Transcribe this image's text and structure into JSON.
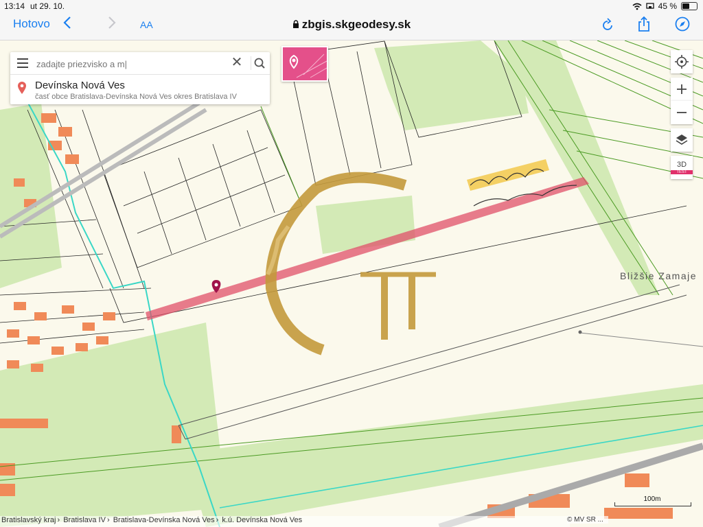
{
  "status_bar": {
    "time": "13:14",
    "date": "ut 29. 10.",
    "battery_level": "45 %",
    "battery_fraction": 0.45
  },
  "browser": {
    "done_label": "Hotovo",
    "text_size_label": "AA",
    "url": "zbgis.skgeodesy.sk",
    "icons": [
      "back-icon",
      "forward-icon",
      "lock-icon",
      "reload-icon",
      "share-icon",
      "compass-icon"
    ]
  },
  "search": {
    "placeholder": "zadajte priezvisko a m|",
    "result_title": "Devínska Nová Ves",
    "result_subtitle": "časť obce Bratislava-Devínska Nová Ves okres Bratislava IV"
  },
  "map_controls": {
    "threed_label": "3D",
    "test_badge": "TEST",
    "icons": [
      "locate-icon",
      "zoom-in-icon",
      "zoom-out-icon",
      "layers-icon"
    ]
  },
  "map": {
    "place_label": "Bližšie Zamaje",
    "scale_label": "100m",
    "attribution": "© MV SR ...",
    "colors": {
      "highlight_parcel": "#e0506a",
      "vegetation": "#d3eab6",
      "buildings": "#f08a58",
      "water_boundary": "#3ad7c6",
      "watermark_gold": "#c49a3c",
      "marker": "#a0124a"
    }
  },
  "breadcrumb": [
    "Bratislavský kraj",
    "Bratislava IV",
    "Bratislava-Devínska Nová Ves",
    "k.ú. Devínska Nová Ves"
  ]
}
